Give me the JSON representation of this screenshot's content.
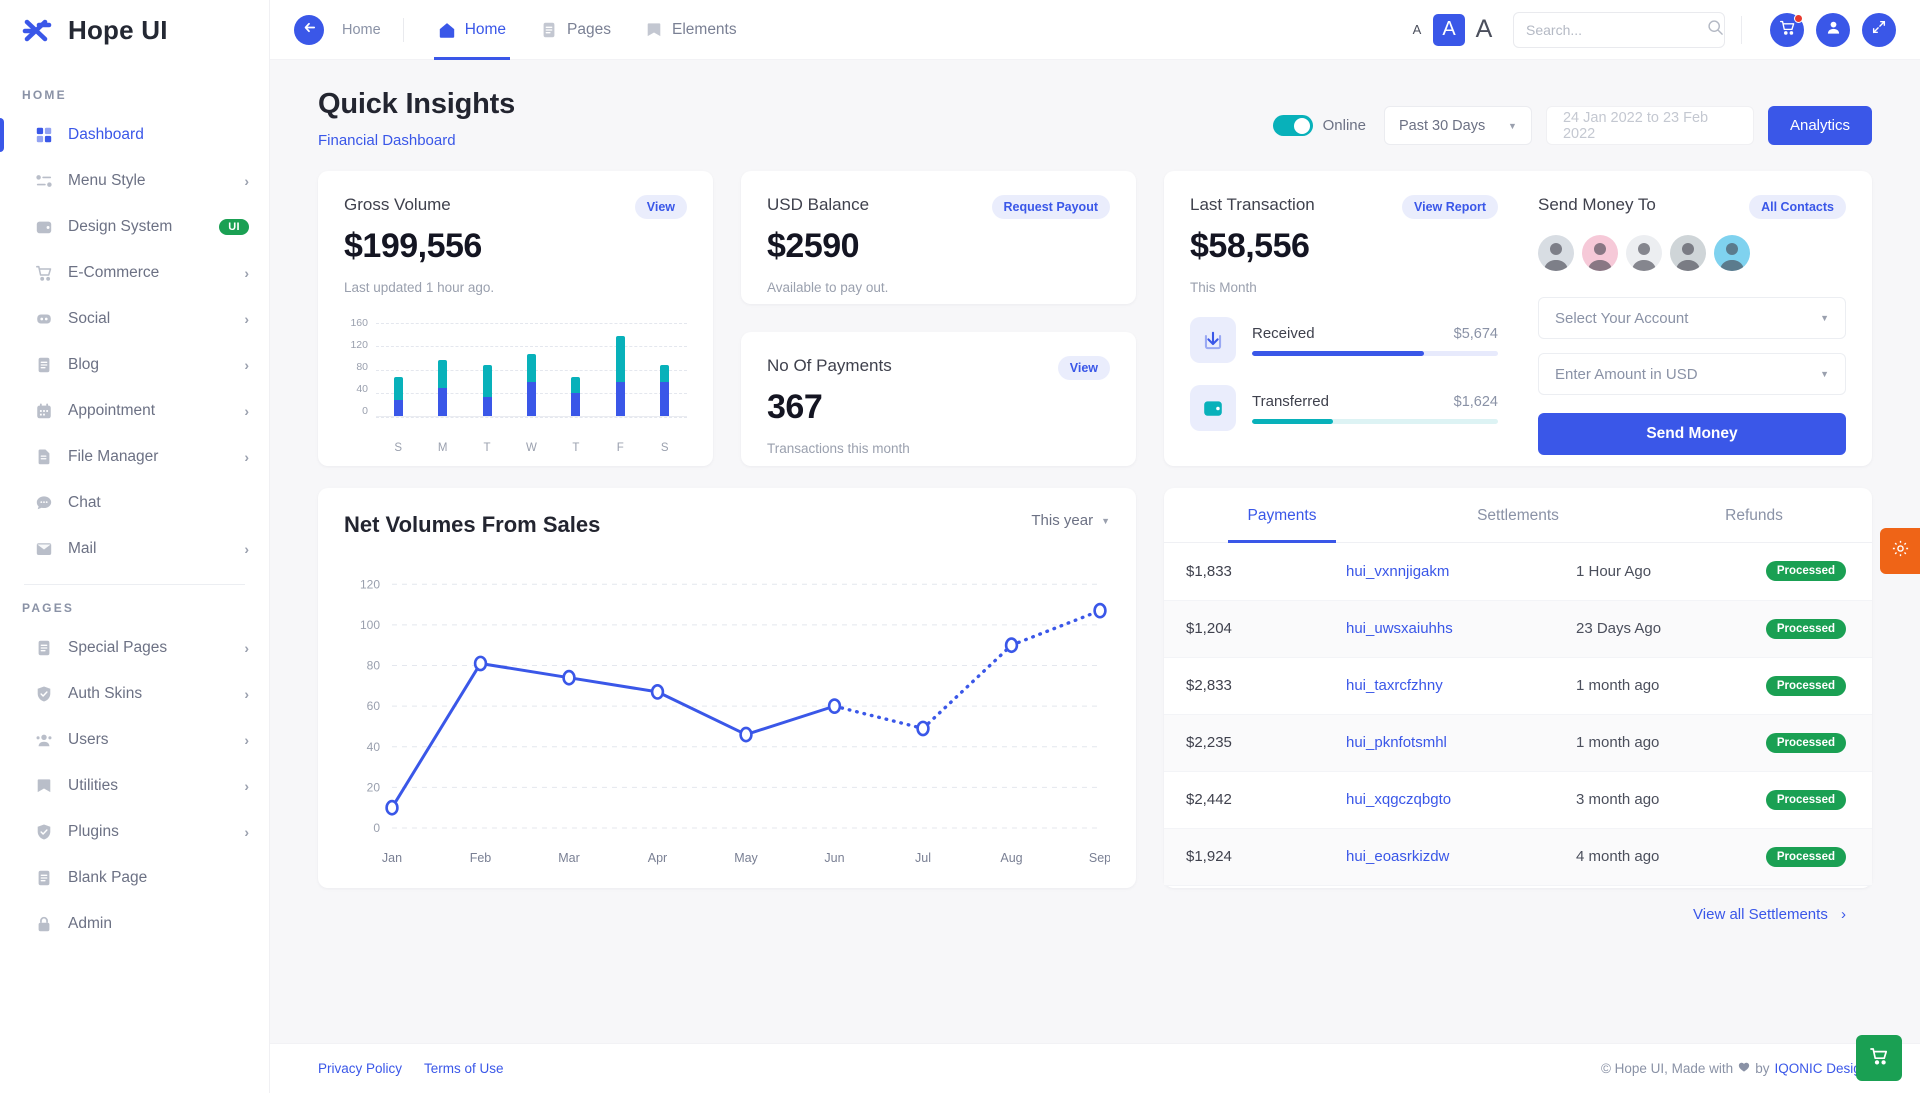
{
  "brand": {
    "name": "Hope UI",
    "logo_icon": "hope-ui-logo-icon"
  },
  "sidebar": {
    "sections": [
      {
        "caption": "HOME",
        "items": [
          {
            "label": "Dashboard",
            "icon": "grid-icon",
            "arrow": false,
            "active": true,
            "badge": ""
          },
          {
            "label": "Menu Style",
            "icon": "list-icon",
            "arrow": true,
            "active": false,
            "badge": ""
          },
          {
            "label": "Design System",
            "icon": "wallet-icon",
            "arrow": false,
            "active": false,
            "badge": "UI"
          },
          {
            "label": "E-Commerce",
            "icon": "cart-icon",
            "arrow": true,
            "active": false,
            "badge": ""
          },
          {
            "label": "Social",
            "icon": "social-icon",
            "arrow": true,
            "active": false,
            "badge": ""
          },
          {
            "label": "Blog",
            "icon": "document-icon",
            "arrow": true,
            "active": false,
            "badge": ""
          },
          {
            "label": "Appointment",
            "icon": "calendar-icon",
            "arrow": true,
            "active": false,
            "badge": ""
          },
          {
            "label": "File Manager",
            "icon": "file-icon",
            "arrow": true,
            "active": false,
            "badge": ""
          },
          {
            "label": "Chat",
            "icon": "chat-bubble-icon",
            "arrow": false,
            "active": false,
            "badge": ""
          },
          {
            "label": "Mail",
            "icon": "envelope-icon",
            "arrow": true,
            "active": false,
            "badge": ""
          }
        ]
      },
      {
        "caption": "PAGES",
        "items": [
          {
            "label": "Special Pages",
            "icon": "document-icon",
            "arrow": true,
            "active": false,
            "badge": ""
          },
          {
            "label": "Auth Skins",
            "icon": "shield-icon",
            "arrow": true,
            "active": false,
            "badge": ""
          },
          {
            "label": "Users",
            "icon": "users-icon",
            "arrow": true,
            "active": false,
            "badge": ""
          },
          {
            "label": "Utilities",
            "icon": "flag-icon",
            "arrow": true,
            "active": false,
            "badge": ""
          },
          {
            "label": "Plugins",
            "icon": "shield-icon",
            "arrow": true,
            "active": false,
            "badge": ""
          },
          {
            "label": "Blank Page",
            "icon": "document-icon",
            "arrow": false,
            "active": false,
            "badge": ""
          },
          {
            "label": "Admin",
            "icon": "lock-icon",
            "arrow": false,
            "active": false,
            "badge": ""
          }
        ]
      }
    ]
  },
  "topbar": {
    "back_icon": "arrow-left-icon",
    "breadcrumb": "Home",
    "tabs": [
      {
        "label": "Home",
        "icon": "home-icon",
        "active": true
      },
      {
        "label": "Pages",
        "icon": "document-icon",
        "active": false
      },
      {
        "label": "Elements",
        "icon": "flag-icon",
        "active": false
      }
    ],
    "font_sizes": {
      "small": "A",
      "medium": "A",
      "large": "A"
    },
    "search_placeholder": "Search...",
    "search_value": "",
    "search_icon": "search-icon",
    "actions": [
      {
        "icon": "cart-icon",
        "badge": true
      },
      {
        "icon": "user-icon",
        "badge": false
      },
      {
        "icon": "fullscreen-icon",
        "badge": false
      }
    ]
  },
  "page": {
    "title": "Quick Insights",
    "subtitle": "Financial Dashboard",
    "toggle_label": "Online",
    "toggle_on": true,
    "range_select": "Past 30 Days",
    "date_placeholder": "24 Jan 2022 to 23 Feb 2022",
    "analytics_button": "Analytics"
  },
  "cards": {
    "gross_volume": {
      "title": "Gross Volume",
      "action": "View",
      "value": "$199,556",
      "note": "Last updated 1 hour ago."
    },
    "usd_balance": {
      "title": "USD Balance",
      "action": "Request Payout",
      "value": "$2590",
      "note": "Available to pay out."
    },
    "no_of_payments": {
      "title": "No Of Payments",
      "action": "View",
      "value": "367",
      "note": "Transactions this month"
    },
    "last_transaction": {
      "title": "Last Transaction",
      "action": "View Report",
      "value": "$58,556",
      "note": "This Month",
      "rows": [
        {
          "label": "Received",
          "amount": "$5,674",
          "percent": 70,
          "color": "#3a57e8",
          "track": "#e7eafc",
          "icon": "download-arrow-icon"
        },
        {
          "label": "Transferred",
          "amount": "$1,624",
          "percent": 33,
          "color": "#08b1ba",
          "track": "#ddf3f4",
          "icon": "wallet-icon"
        }
      ]
    },
    "send_money": {
      "title": "Send Money To",
      "action": "All Contacts",
      "contacts": [
        {
          "name": "contact-1",
          "bg": "#d8dde3"
        },
        {
          "name": "contact-2",
          "bg": "#f6c9d8"
        },
        {
          "name": "contact-3",
          "bg": "#eceef1"
        },
        {
          "name": "contact-4",
          "bg": "#cfd5d8"
        },
        {
          "name": "contact-5",
          "bg": "#7fd2ef"
        }
      ],
      "account_placeholder": "Select Your Account",
      "amount_placeholder": "Enter Amount in USD",
      "send_button": "Send Money"
    },
    "net_volumes": {
      "title": "Net Volumes From Sales",
      "range": "This year"
    }
  },
  "transactions_panel": {
    "tabs": [
      {
        "label": "Payments",
        "active": true
      },
      {
        "label": "Settlements",
        "active": false
      },
      {
        "label": "Refunds",
        "active": false
      }
    ],
    "rows": [
      {
        "amount": "$1,833",
        "id": "hui_vxnnjigakm",
        "time": "1 Hour Ago",
        "status": "Processed"
      },
      {
        "amount": "$1,204",
        "id": "hui_uwsxaiuhhs",
        "time": "23 Days Ago",
        "status": "Processed"
      },
      {
        "amount": "$2,833",
        "id": "hui_taxrcfzhny",
        "time": "1 month ago",
        "status": "Processed"
      },
      {
        "amount": "$2,235",
        "id": "hui_pknfotsmhl",
        "time": "1 month ago",
        "status": "Processed"
      },
      {
        "amount": "$2,442",
        "id": "hui_xqgczqbgto",
        "time": "3 month ago",
        "status": "Processed"
      },
      {
        "amount": "$1,924",
        "id": "hui_eoasrkizdw",
        "time": "4 month ago",
        "status": "Processed"
      }
    ],
    "view_all": "View all Settlements"
  },
  "footer": {
    "links": [
      "Privacy Policy",
      "Terms of Use"
    ],
    "copy_prefix": "© Hope UI, Made with",
    "heart_icon": "heart-icon",
    "copy_mid": "by",
    "brand_link": "IQONIC Design."
  },
  "floating": {
    "gear_icon": "gear-icon",
    "cart_icon": "cart-icon"
  },
  "colors": {
    "primary": "#3a57e8",
    "teal": "#08b1ba",
    "green": "#1aa053",
    "orange": "#ef6417",
    "muted": "#8a92a6"
  },
  "chart_data": [
    {
      "type": "bar",
      "name": "gross-volume-bar-chart",
      "title": "Gross Volume",
      "stacked": true,
      "categories": [
        "S",
        "M",
        "T",
        "W",
        "T",
        "F",
        "S"
      ],
      "series": [
        {
          "name": "lower",
          "color": "#3a57e8",
          "values": [
            28,
            48,
            33,
            58,
            39,
            58,
            58
          ]
        },
        {
          "name": "upper",
          "color": "#08b1ba",
          "values": [
            39,
            48,
            54,
            48,
            28,
            78,
            29
          ]
        }
      ],
      "totals": [
        67,
        96,
        87,
        106,
        67,
        136,
        87
      ],
      "yticks": [
        0,
        40,
        80,
        120,
        160
      ],
      "ylim": [
        0,
        170
      ],
      "xlabel": "",
      "ylabel": "",
      "grid": true,
      "legend": "none"
    },
    {
      "type": "line",
      "name": "net-volumes-line-chart",
      "title": "Net Volumes From Sales",
      "categories": [
        "Jan",
        "Feb",
        "Mar",
        "Apr",
        "May",
        "Jun",
        "Jul",
        "Aug",
        "Sep"
      ],
      "values": [
        10,
        81,
        74,
        67,
        46,
        60,
        49,
        90,
        107
      ],
      "solid_until_index": 5,
      "line_color": "#3a57e8",
      "marker": "open-circle",
      "yticks": [
        0,
        20,
        40,
        60,
        80,
        100,
        120
      ],
      "ylim": [
        0,
        128
      ],
      "xlabel": "",
      "ylabel": "",
      "grid": true,
      "legend": "none"
    }
  ]
}
